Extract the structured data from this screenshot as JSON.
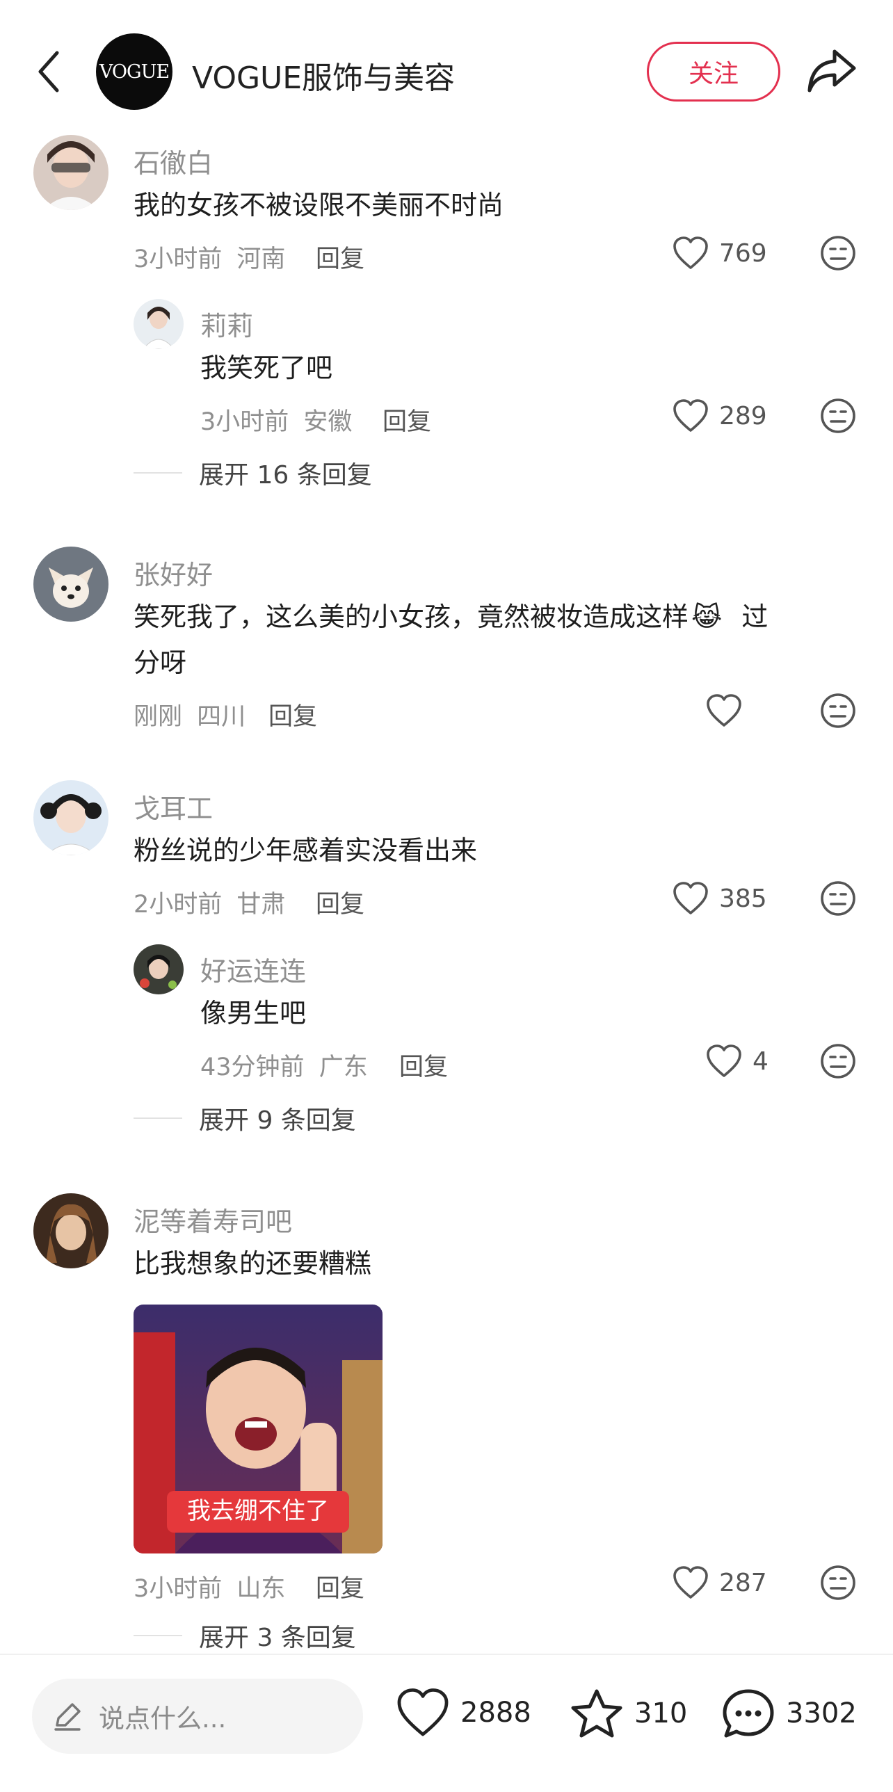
{
  "header": {
    "brand_logo_text": "VOGUE",
    "brand_name": "VOGUE服饰与美容",
    "follow_label": "关注"
  },
  "comments": [
    {
      "user": "石徹白",
      "text": "我的女孩不被设限不美丽不时尚",
      "time": "3小时前",
      "location": "河南",
      "reply_label": "回复",
      "likes": "769",
      "replies": [
        {
          "user": "莉莉",
          "text": "我笑死了吧",
          "time": "3小时前",
          "location": "安徽",
          "reply_label": "回复",
          "likes": "289"
        }
      ],
      "expand_label": "展开 16 条回复"
    },
    {
      "user": "张好好",
      "text_line1": "笑死我了，这么美的小女孩，竟然被妆造成这样",
      "text_emoji": "😹",
      "text_after_emoji": "过",
      "text_line2": "分呀",
      "time": "刚刚",
      "location": "四川",
      "reply_label": "回复",
      "likes": ""
    },
    {
      "user": "戈耳工",
      "text": "粉丝说的少年感着实没看出来",
      "time": "2小时前",
      "location": "甘肃",
      "reply_label": "回复",
      "likes": "385",
      "replies": [
        {
          "user": "好运连连",
          "text": "像男生吧",
          "time": "43分钟前",
          "location": "广东",
          "reply_label": "回复",
          "likes": "4"
        }
      ],
      "expand_label": "展开 9 条回复"
    },
    {
      "user": "泥等着寿司吧",
      "text": "比我想象的还要糟糕",
      "image_caption": "我去绷不住了",
      "time": "3小时前",
      "location": "山东",
      "reply_label": "回复",
      "likes": "287",
      "expand_label": "展开 3 条回复"
    }
  ],
  "bottom_bar": {
    "input_placeholder": "说点什么...",
    "likes": "2888",
    "favorites": "310",
    "comments": "3302"
  },
  "colors": {
    "accent": "#e3304f",
    "muted_text": "#8f8f8f",
    "body_text": "#1e1e1e"
  }
}
